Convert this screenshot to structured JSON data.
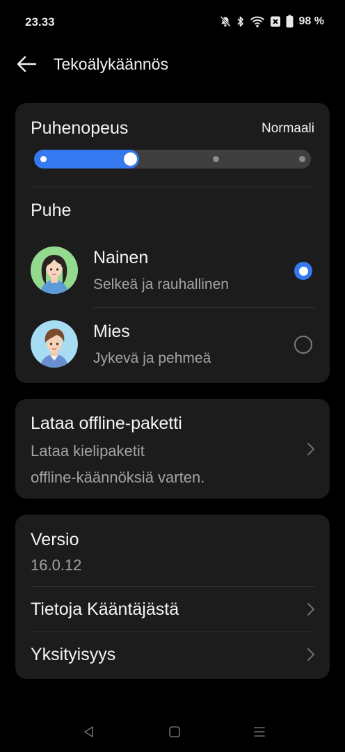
{
  "status_bar": {
    "time": "23.33",
    "battery": "98 %",
    "icons": [
      "mute-bell-icon",
      "bluetooth-icon",
      "wifi-icon",
      "data-saver-icon",
      "battery-icon"
    ]
  },
  "header": {
    "title": "Tekoälykäännös",
    "back_icon": "arrow-left-icon"
  },
  "speech_settings": {
    "speed_label": "Puhenopeus",
    "speed_value": "Normaali",
    "speed_steps": 4,
    "speed_selected_index": 1,
    "voice_heading": "Puhe",
    "voices": [
      {
        "name": "Nainen",
        "description": "Selkeä ja rauhallinen",
        "selected": true
      },
      {
        "name": "Mies",
        "description": "Jykevä ja pehmeä",
        "selected": false
      }
    ]
  },
  "offline": {
    "title": "Lataa offline-paketti",
    "subtitle_line1": "Lataa kielipaketit",
    "subtitle_line2": "offline-käännöksiä varten."
  },
  "about": {
    "version_label": "Versio",
    "version_value": "16.0.12",
    "about_label": "Tietoja Kääntäjästä",
    "privacy_label": "Yksityisyys"
  },
  "colors": {
    "accent": "#3479ef",
    "card": "#1c1c1c",
    "background": "#000000",
    "secondary_text": "#a3a3a3"
  }
}
